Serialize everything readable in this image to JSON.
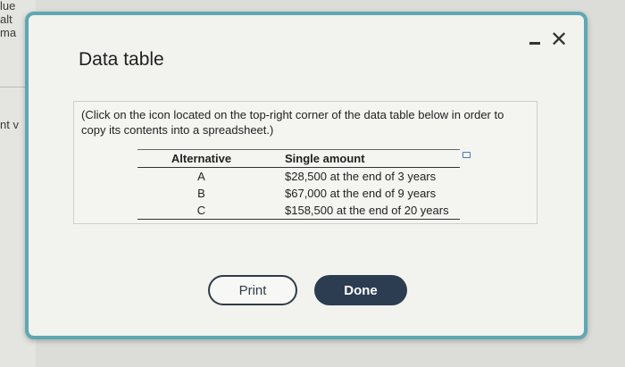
{
  "background": {
    "fragments": [
      "lue",
      "alt",
      "ma",
      "nt v"
    ]
  },
  "dialog": {
    "title": "Data table",
    "minimize_label": "-",
    "close_label": "✕",
    "instructions": "(Click on the icon located on the top-right corner of the data table below in order to copy its contents into a spreadsheet.)",
    "table": {
      "headers": [
        "Alternative",
        "Single amount"
      ],
      "rows": [
        [
          "A",
          "$28,500 at the end of 3 years"
        ],
        [
          "B",
          "$67,000 at the end of 9 years"
        ],
        [
          "C",
          "$158,500 at the end of 20 years"
        ]
      ]
    },
    "buttons": {
      "print": "Print",
      "done": "Done"
    }
  },
  "colors": {
    "dialog_border": "#5fa7b3",
    "done_button": "#2c3d52"
  }
}
